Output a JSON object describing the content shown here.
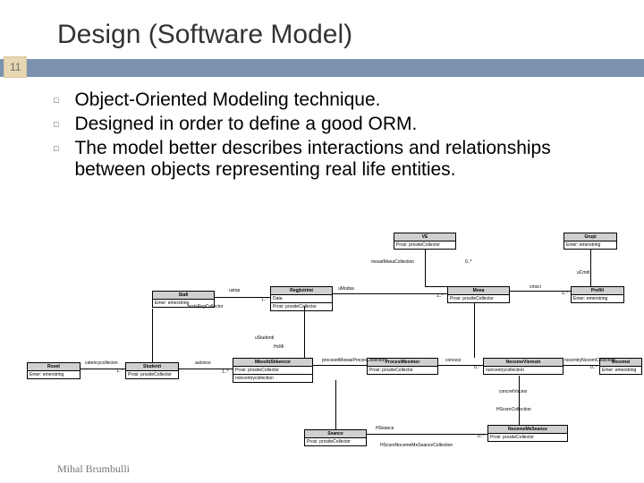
{
  "title": "Design (Software Model)",
  "page_number": "11",
  "bullets": [
    "Object-Oriented Modeling technique.",
    "Designed in order to define a good ORM.",
    "The model better describes interactions and relationships between objects representing real life entities."
  ],
  "author": "Mihal Brumbulli",
  "diagram": {
    "classes": {
      "VE": {
        "name": "VE",
        "attrs": [
          "Prosi: prositeCollector"
        ]
      },
      "Grupi": {
        "name": "Grupi",
        "attrs": [
          "Emer: emerstring"
        ]
      },
      "Moea": {
        "name": "Moea",
        "attrs": [
          "Prosi: prositeCollector"
        ]
      },
      "Profili": {
        "name": "Profili",
        "attrs": [
          "Emer: emerstring"
        ]
      },
      "Stafi": {
        "name": "Stafi",
        "attrs": [
          "Emer: emerstring"
        ]
      },
      "Regjistrimi": {
        "name": "Regjistrimi",
        "attrs": [
          "Data",
          "Prosi: prositeCollector"
        ]
      },
      "Studenti": {
        "name": "Studenti",
        "attrs": [
          "Prosi: prositeCollector"
        ]
      },
      "Roset": {
        "name": "Roset",
        "attrs": [
          "Emer: emerstring"
        ]
      },
      "MbeshtShkencor": {
        "name": "MbeshtShkencor",
        "attrs": [
          "Prosi: prositeCollector",
          "noncentrycollection"
        ]
      },
      "ProcesiMesimor": {
        "name": "ProcesiMesimor",
        "attrs": [
          "Prosi: prositeCollector"
        ]
      },
      "NocemeVleresin": {
        "name": "NocemeVleresin",
        "attrs": [
          "noncentrycollection"
        ]
      },
      "Nocemei": {
        "name": "Nocemei",
        "attrs": [
          "Emer: emerstring"
        ]
      },
      "Seance": {
        "name": "Seance",
        "attrs": [
          "Prosi: prositeCollector"
        ]
      },
      "NocemeMeSeance": {
        "name": "NocemeMeSeance",
        "attrs": [
          "Prosi: prositeCollector"
        ]
      }
    },
    "labels": {
      "VE_Moea": "mosatMoeaCollection",
      "Grupi_Moea": "uCmdi",
      "Moea_Profili": "cmxci",
      "Stafi_Regj": "ustop",
      "Regj_Moea": "uModsa",
      "Regj_Stud": "testsRegCollector",
      "Stud_hd": "uStudenti",
      "Moea_hd": "HcMi",
      "Roset_Stud": "catencycollecion",
      "Stud_Mbesh": "autonce",
      "proc_link": "procesetMoeaeProcesCollection",
      "Proc_Noc": "concesi",
      "NocV_Noc": "nocentryNocemCollection",
      "NocV_conc": "concretVocesi",
      "Seance_hd": "HSeance",
      "NocMS_label": "HScoreCollection",
      "NocMS_hd": "HScoreNocemeMeSeanceCollection"
    },
    "multiplicities": [
      "0..*",
      "1..*",
      "1"
    ]
  }
}
